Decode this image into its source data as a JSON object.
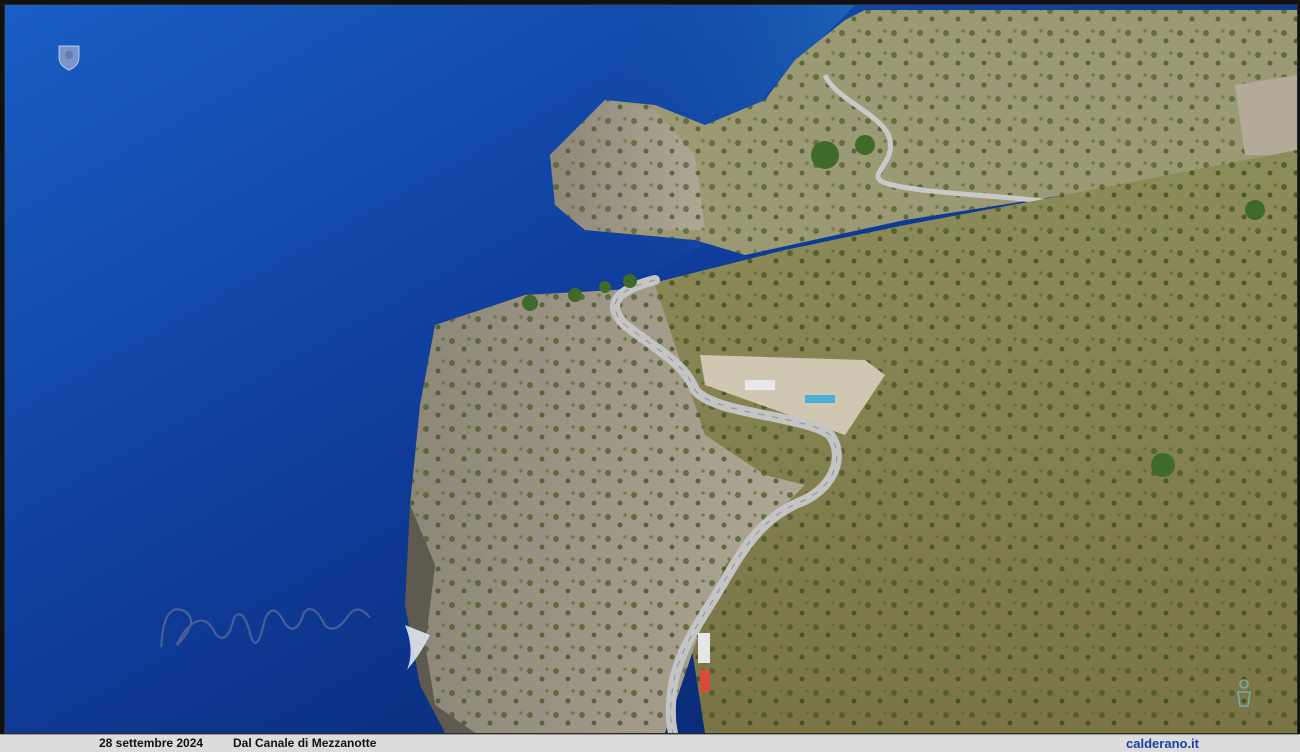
{
  "photo": {
    "subject": "",
    "colors": {
      "sea_deep": "#0a2a7a",
      "sea_mid": "#1248b0",
      "sea_light": "#2a8fd0",
      "cliff": "#a8a090",
      "vegetation": "#6b7a3a",
      "road": "#b8b8b8"
    }
  },
  "caption": {
    "date": "28 settembre 2024",
    "title": "Dal Canale di Mezzanotte",
    "site": "calderano.it"
  },
  "watermark": {
    "signature": "Pino Calderano"
  }
}
